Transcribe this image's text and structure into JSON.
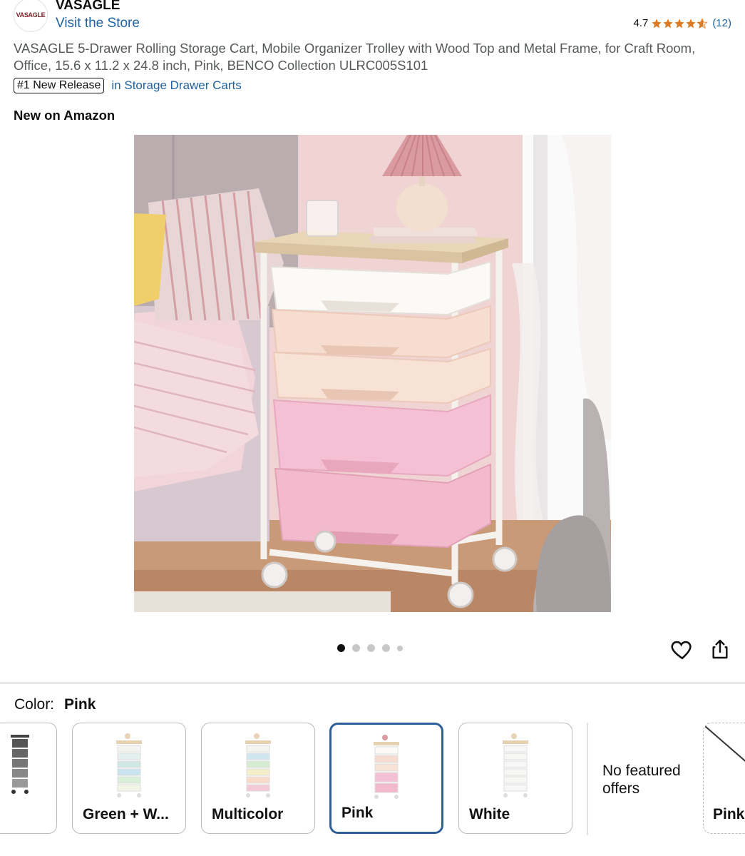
{
  "header": {
    "brand_logo_text": "VASAGLE",
    "brand_name": "VASAGLE",
    "visit_store": "Visit the Store",
    "rating_value": "4.7",
    "rating_stars": 4.7,
    "rating_count": "(12)"
  },
  "product": {
    "title": "VASAGLE 5-Drawer Rolling Storage Cart, Mobile Organizer Trolley with Wood Top and Metal Frame, for Craft Room, Office, 15.6 x 11.2 x 24.8 inch, Pink, BENCO Collection ULRC005S101",
    "badge": "#1 New Release",
    "badge_category": "in Storage Drawer Carts",
    "new_on_amazon": "New on Amazon",
    "image_count": 5,
    "active_image": 1
  },
  "color": {
    "label": "Color:",
    "selected": "Pink",
    "options": [
      {
        "label": "",
        "variant": "black"
      },
      {
        "label": "Green + W...",
        "variant": "green-white"
      },
      {
        "label": "Multicolor",
        "variant": "multicolor"
      },
      {
        "label": "Pink",
        "variant": "pink",
        "selected": true
      },
      {
        "label": "White",
        "variant": "white"
      }
    ],
    "no_offers": "No featured offers",
    "unavailable_option": "Pink"
  },
  "colors": {
    "link": "#2162a1",
    "star": "#de7921",
    "selected_border": "#2f5f99"
  }
}
